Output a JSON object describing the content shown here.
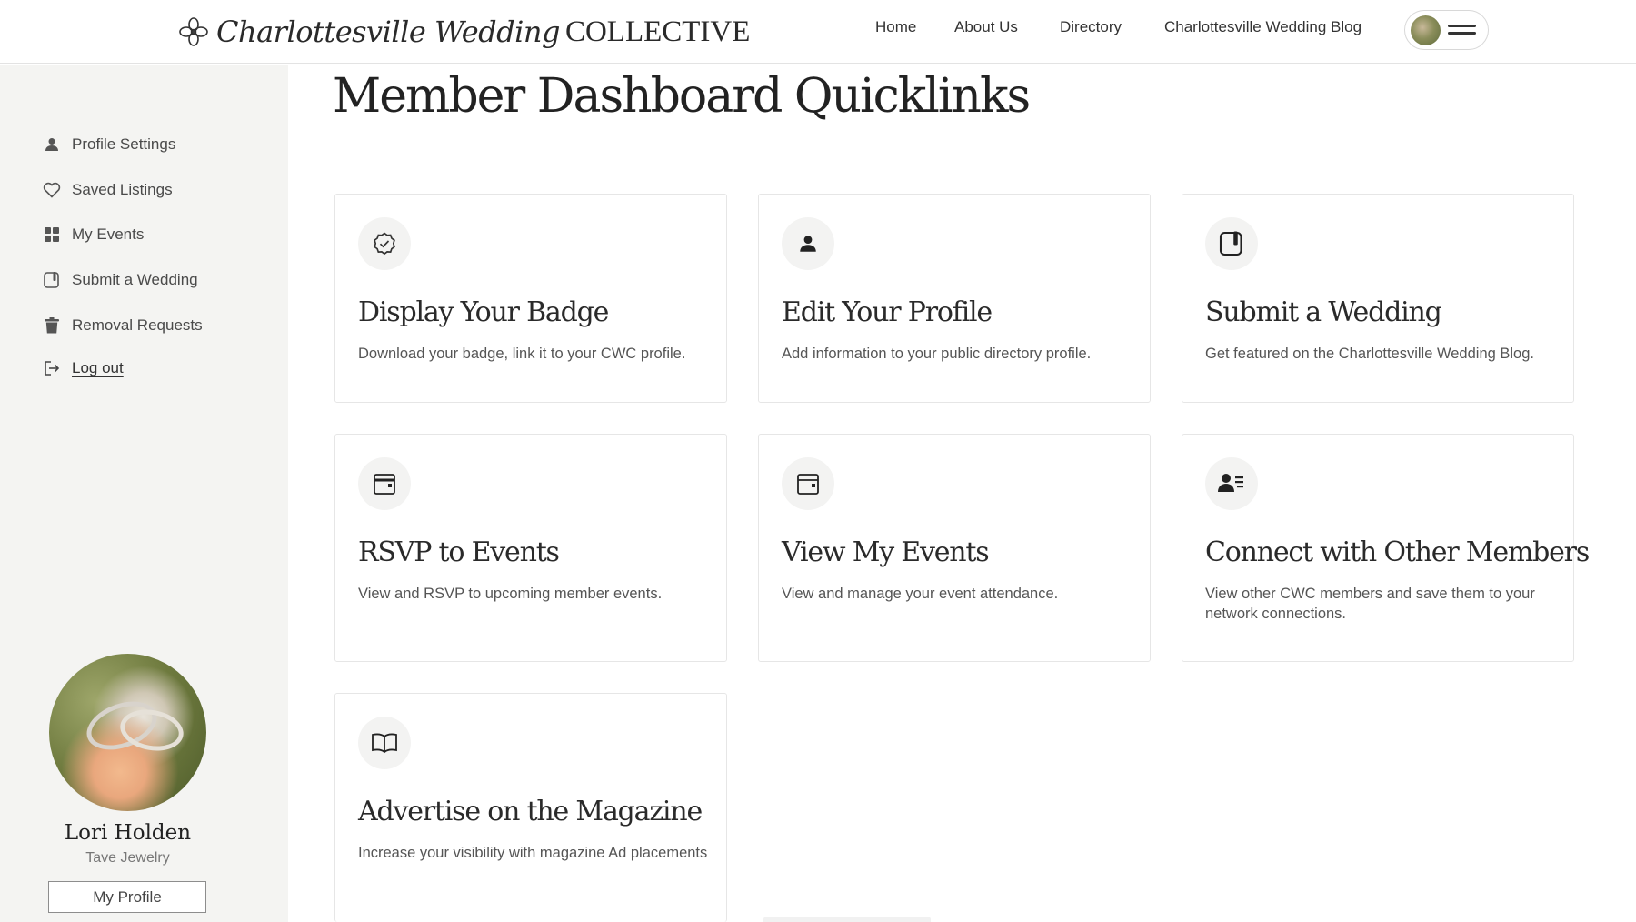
{
  "brand": {
    "script": "Charlottesville Wedding",
    "caps": "COLLECTIVE"
  },
  "nav": {
    "items": [
      "Home",
      "About Us",
      "Directory",
      "Charlottesville Wedding Blog"
    ]
  },
  "sidebar": {
    "items": [
      {
        "label": "Profile Settings",
        "icon": "person-icon"
      },
      {
        "label": "Saved Listings",
        "icon": "heart-icon"
      },
      {
        "label": "My Events",
        "icon": "grid-icon"
      },
      {
        "label": "Submit a Wedding",
        "icon": "submit-icon"
      },
      {
        "label": "Removal Requests",
        "icon": "trash-icon"
      },
      {
        "label": "Log out",
        "icon": "logout-icon"
      }
    ],
    "profile": {
      "name": "Lori Holden",
      "company": "Tave Jewelry",
      "button": "My Profile"
    }
  },
  "main": {
    "title": "Member Dashboard Quicklinks",
    "cards": [
      {
        "title": "Display Your Badge",
        "description": "Download your badge, link it to your CWC profile.",
        "icon": "badge-check-icon"
      },
      {
        "title": "Edit Your Profile",
        "description": "Add information to your public directory profile.",
        "icon": "person-icon"
      },
      {
        "title": "Submit a Wedding",
        "description": "Get featured on the Charlottesville Wedding Blog.",
        "icon": "submit-icon"
      },
      {
        "title": "RSVP to Events",
        "description": "View and RSVP to upcoming member events.",
        "icon": "calendar-icon"
      },
      {
        "title": "View My Events",
        "description": "View and manage your event attendance.",
        "icon": "calendar-icon"
      },
      {
        "title": "Connect with Other Members",
        "description": "View other CWC members and save them to your network connections.",
        "icon": "contact-card-icon"
      },
      {
        "title": "Advertise on the Magazine",
        "description": "Increase your visibility with magazine Ad placements",
        "icon": "open-book-icon"
      }
    ]
  },
  "colors": {
    "sidebar_bg": "#f4f4f2",
    "text": "#222222",
    "muted": "#555555"
  }
}
